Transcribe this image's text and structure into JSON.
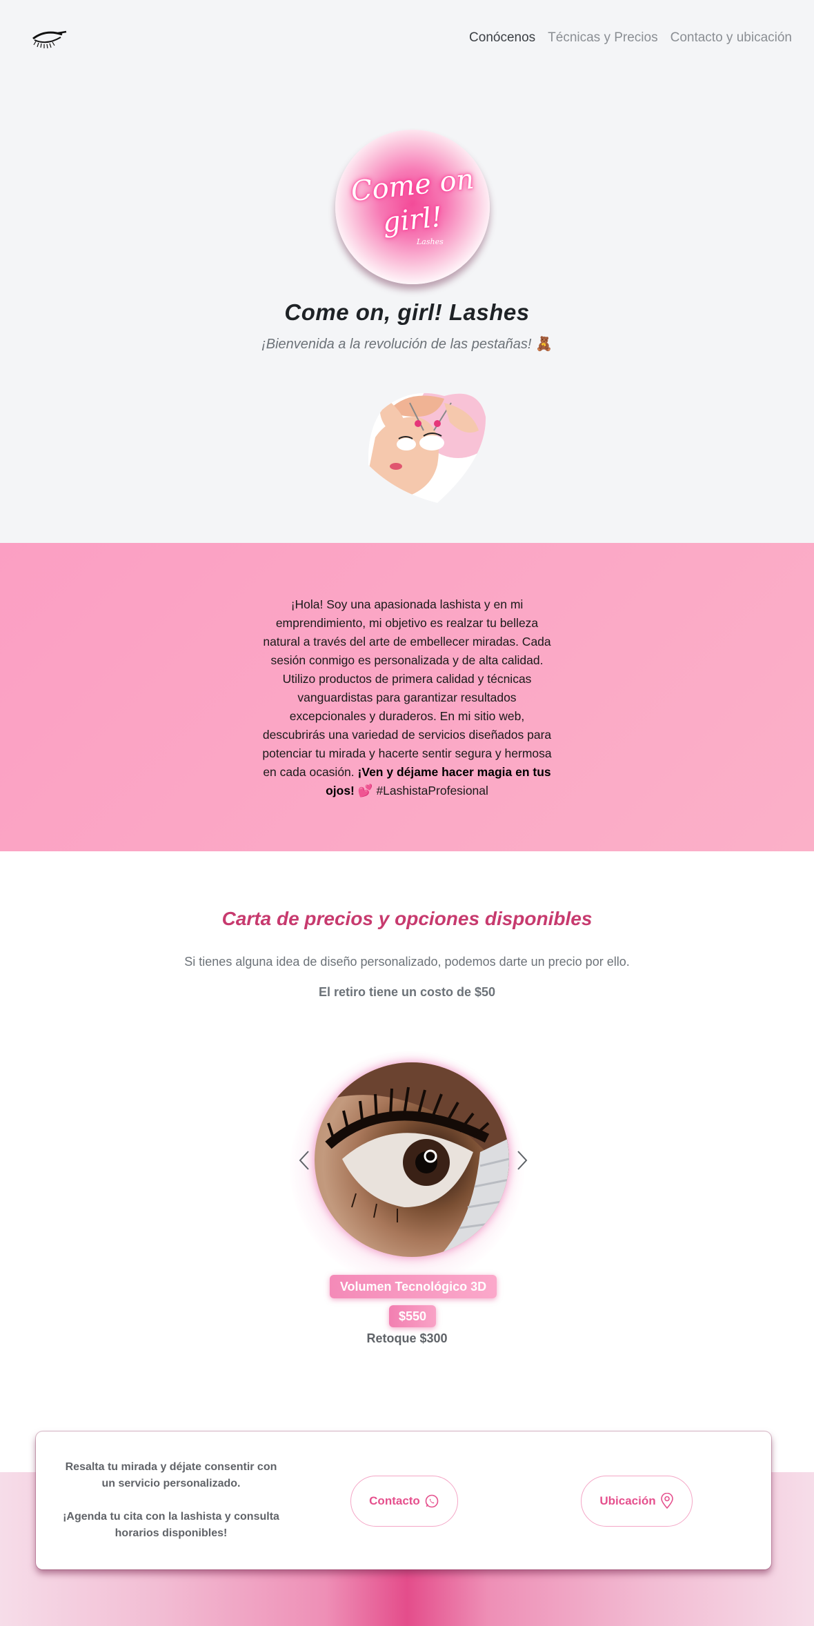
{
  "nav": {
    "links": [
      {
        "label": "Conócenos",
        "active": true
      },
      {
        "label": "Técnicas y Precios",
        "active": false
      },
      {
        "label": "Contacto y ubicación",
        "active": false
      }
    ],
    "logo_icon": "eyelash-icon"
  },
  "hero": {
    "logo": {
      "line1": "Come on",
      "line2": "girl!",
      "line3": "Lashes"
    },
    "title": "Come on, girl! Lashes",
    "subtitle": "¡Bienvenida a la revolución de las pestañas!",
    "subtitle_emoji": "🧸",
    "illustration_icon": "lash-application-illustration"
  },
  "about": {
    "text": "¡Hola! Soy una apasionada lashista y en mi emprendimiento, mi objetivo es realzar tu belleza natural a través del arte de embellecer miradas. Cada sesión conmigo es personalizada y de alta calidad. Utilizo productos de primera calidad y técnicas vanguardistas para garantizar resultados excepcionales y duraderos. En mi sitio web, descubrirás una variedad de servicios diseñados para potenciar tu mirada y hacerte sentir segura y hermosa en cada ocasión.",
    "bold_text": "¡Ven y déjame hacer magia en tus ojos!",
    "emoji": "💕",
    "hashtag": "#LashistaProfesional"
  },
  "prices": {
    "title": "Carta de precios y opciones disponibles",
    "lead": "Si tienes alguna idea de diseño personalizado, podemos darte un precio por ello.",
    "note": "El retiro tiene un costo de $50",
    "carousel": {
      "service_name": "Volumen Tecnológico 3D",
      "price": "$550",
      "touchup": "Retoque $300",
      "prev_icon": "chevron-left-icon",
      "next_icon": "chevron-right-icon"
    }
  },
  "footer": {
    "line1": "Resalta tu mirada y déjate consentir con un servicio personalizado.",
    "line2": "¡Agenda tu cita con la lashista y consulta horarios disponibles!",
    "contact_label": "Contacto",
    "contact_icon": "whatsapp-icon",
    "location_label": "Ubicación",
    "location_icon": "map-pin-icon"
  },
  "colors": {
    "accent": "#e5508d",
    "title_pink": "#c73a6e",
    "about_bg": "#fba4c5",
    "page_bg": "#f4f5f7"
  }
}
